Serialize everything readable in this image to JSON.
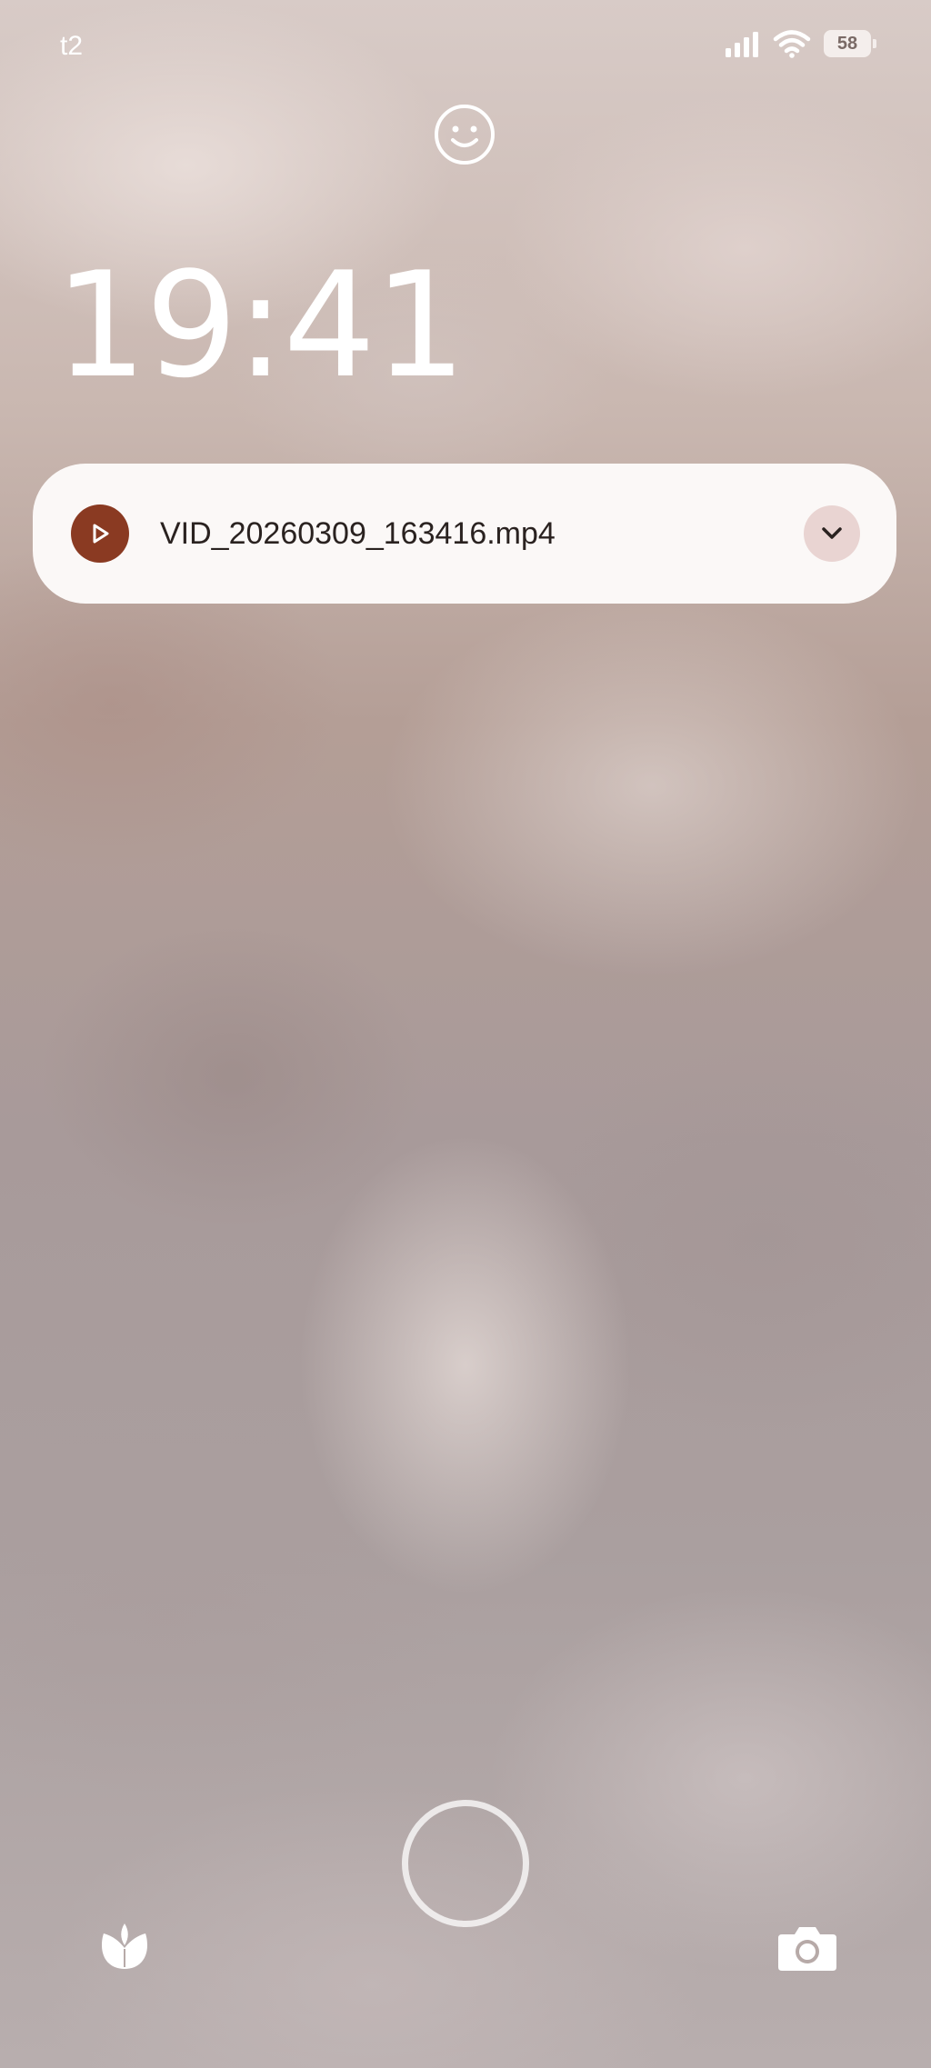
{
  "status_bar": {
    "carrier": "t2",
    "battery_level": "58",
    "signal_icon": "signal-bars-icon",
    "wifi_icon": "wifi-icon"
  },
  "lockscreen": {
    "time": "19:41",
    "face_unlock_icon": "smiley-face-icon"
  },
  "notification": {
    "app_icon": "play-icon",
    "title": "VID_20260309_163416.mp4",
    "expand_icon": "chevron-down-icon"
  },
  "bottom": {
    "left_shortcut_icon": "flower-icon",
    "right_shortcut_icon": "camera-icon",
    "unlock_indicator": "fingerprint-ring"
  }
}
